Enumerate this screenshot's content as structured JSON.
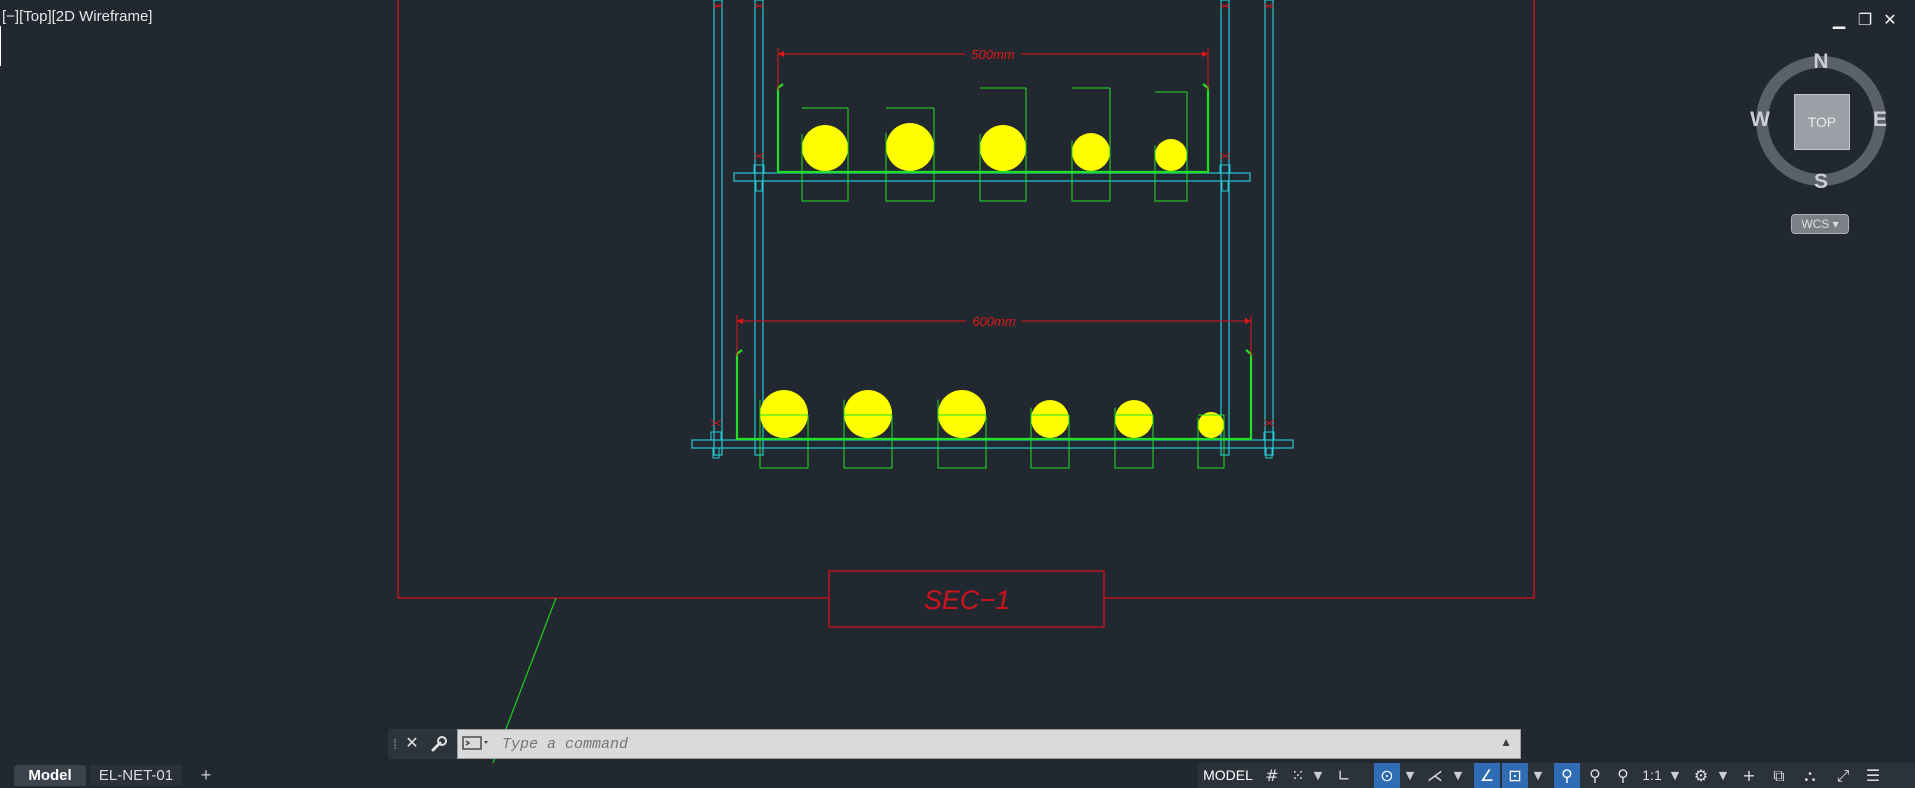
{
  "viewport": {
    "label": "[−][Top][2D Wireframe]"
  },
  "window_controls": {
    "minimize": "▁",
    "restore": "❐",
    "close": "✕"
  },
  "viewcube": {
    "north": "N",
    "south": "S",
    "east": "E",
    "west": "W",
    "face": "TOP",
    "wcs": "WCS ▾"
  },
  "drawing": {
    "upper_dimension": "500mm",
    "lower_dimension": "600mm",
    "section_label": "SEC−1",
    "colors": {
      "frame": "#d1121d",
      "tray": "#22e022",
      "support": "#27c9d4",
      "cable": "#ffff00",
      "dimension": "#e01818"
    }
  },
  "command_line": {
    "placeholder": "Type a command",
    "close_icon": "✕",
    "customize_icon": "wrench",
    "expand_icon": "▲"
  },
  "layout_tabs": {
    "model": "Model",
    "sheet": "EL-NET-01",
    "add": "+"
  },
  "status_bar": {
    "model_label": "MODEL",
    "annotation_scale": "1:1"
  }
}
